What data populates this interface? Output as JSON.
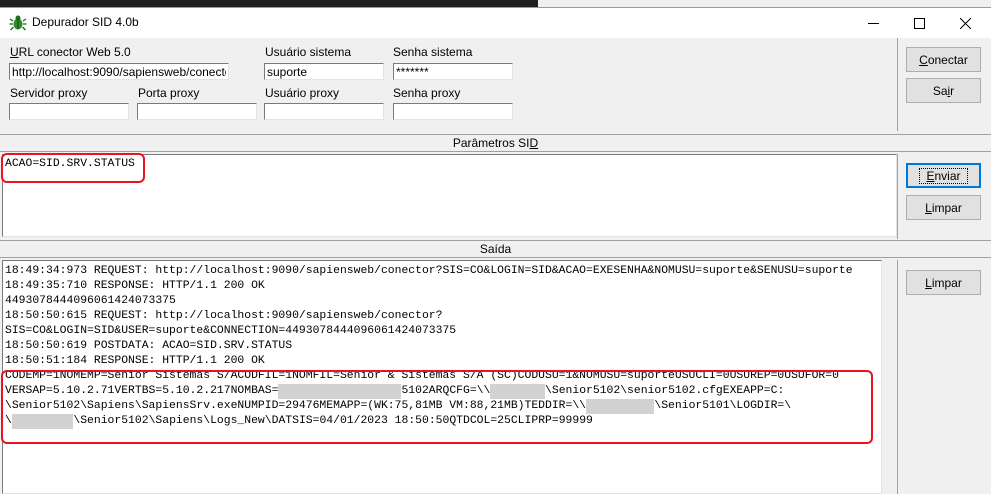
{
  "window": {
    "title": "Depurador SID 4.0b"
  },
  "connection": {
    "url_label": "URL conector Web 5.0",
    "url_value": "http://localhost:9090/sapiensweb/conector",
    "user_label": "Usuário sistema",
    "user_value": "suporte",
    "password_label": "Senha sistema",
    "password_value": "*******",
    "proxy_server_label": "Servidor proxy",
    "proxy_port_label": "Porta proxy",
    "proxy_user_label": "Usuário proxy",
    "proxy_password_label": "Senha proxy"
  },
  "buttons": {
    "connect_pre": "",
    "connect_key": "C",
    "connect_post": "onectar",
    "exit_pre": "Sa",
    "exit_key": "i",
    "exit_post": "r",
    "send_pre": "",
    "send_key": "E",
    "send_post": "nviar",
    "clear_params_pre": "",
    "clear_params_key": "L",
    "clear_params_post": "impar",
    "clear_output_pre": "",
    "clear_output_key": "L",
    "clear_output_post": "impar"
  },
  "params": {
    "header_pre": "Parâmetros SI",
    "header_key": "D",
    "text": "ACAO=SID.SRV.STATUS"
  },
  "output": {
    "header_pre": "Saída",
    "header_key": "",
    "lines": [
      "18:49:34:973 REQUEST: http://localhost:9090/sapiensweb/conector?SIS=CO&LOGIN=SID&ACAO=EXESENHA&NOMUSU=suporte&SENUSU=suporte",
      "18:49:35:710 RESPONSE: HTTP/1.1 200 OK",
      "4493078444096061424073375",
      "18:50:50:615 REQUEST: http://localhost:9090/sapiensweb/conector?",
      "SIS=CO&LOGIN=SID&USER=suporte&CONNECTION=4493078444096061424073375",
      "18:50:50:619 POSTDATA: ACAO=SID.SRV.STATUS",
      "18:50:51:184 RESPONSE: HTTP/1.1 200 OK"
    ],
    "status": {
      "l1": "CODEMP=1NOMEMP=Senior Sistemas S/ACODFIL=1NOMFIL=Senior & Sistemas S/A (SC)CODUSU=1&NOMUSU=suporteUSUCLI=0USUREP=0USUFOR=0",
      "l2a": "VERSAP=5.10.2.71VERTBS=5.10.2.217NOMBAS=",
      "l2b": "5102ARQCFG=\\\\",
      "l2c": "\\Senior5102\\senior5102.cfgEXEAPP=C:",
      "l3a": "\\Senior5102\\Sapiens\\SapiensSrv.exeNUMPID=29476MEMAPP=(WK:75,81MB VM:88,21MB)TEDDIR=\\\\",
      "l3b": "\\Senior5101\\LOGDIR=\\",
      "l4a": "\\",
      "l4b": "\\Senior5102\\Sapiens\\Logs_New\\DATSIS=04/01/2023 18:50:50QTDCOL=25CLIPRP=99999"
    }
  },
  "colors": {
    "highlight": "#e8141e",
    "default_button_border": "#0078d7"
  }
}
